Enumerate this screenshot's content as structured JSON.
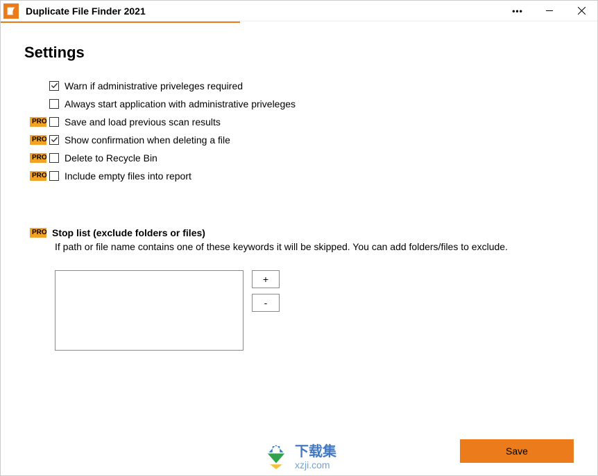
{
  "titlebar": {
    "app_title": "Duplicate File Finder 2021",
    "more_label": "•••"
  },
  "page": {
    "title": "Settings"
  },
  "options": {
    "pro_badge": "PRO",
    "items": [
      {
        "label": "Warn if administrative priveleges required",
        "checked": true,
        "pro": false
      },
      {
        "label": "Always start application with administrative priveleges",
        "checked": false,
        "pro": false
      },
      {
        "label": "Save and load previous scan results",
        "checked": false,
        "pro": true
      },
      {
        "label": "Show confirmation when deleting a file",
        "checked": true,
        "pro": true
      },
      {
        "label": "Delete to Recycle Bin",
        "checked": false,
        "pro": true
      },
      {
        "label": "Include empty files into report",
        "checked": false,
        "pro": true
      }
    ]
  },
  "stoplist": {
    "title": "Stop list (exclude folders or files)",
    "description": "If path or file name contains one of these keywords it will be skipped. You can add folders/files to exclude.",
    "add_label": "+",
    "remove_label": "-"
  },
  "footer": {
    "save_label": "Save"
  },
  "watermark": {
    "cn": "下载集",
    "url": "xzji.com"
  }
}
